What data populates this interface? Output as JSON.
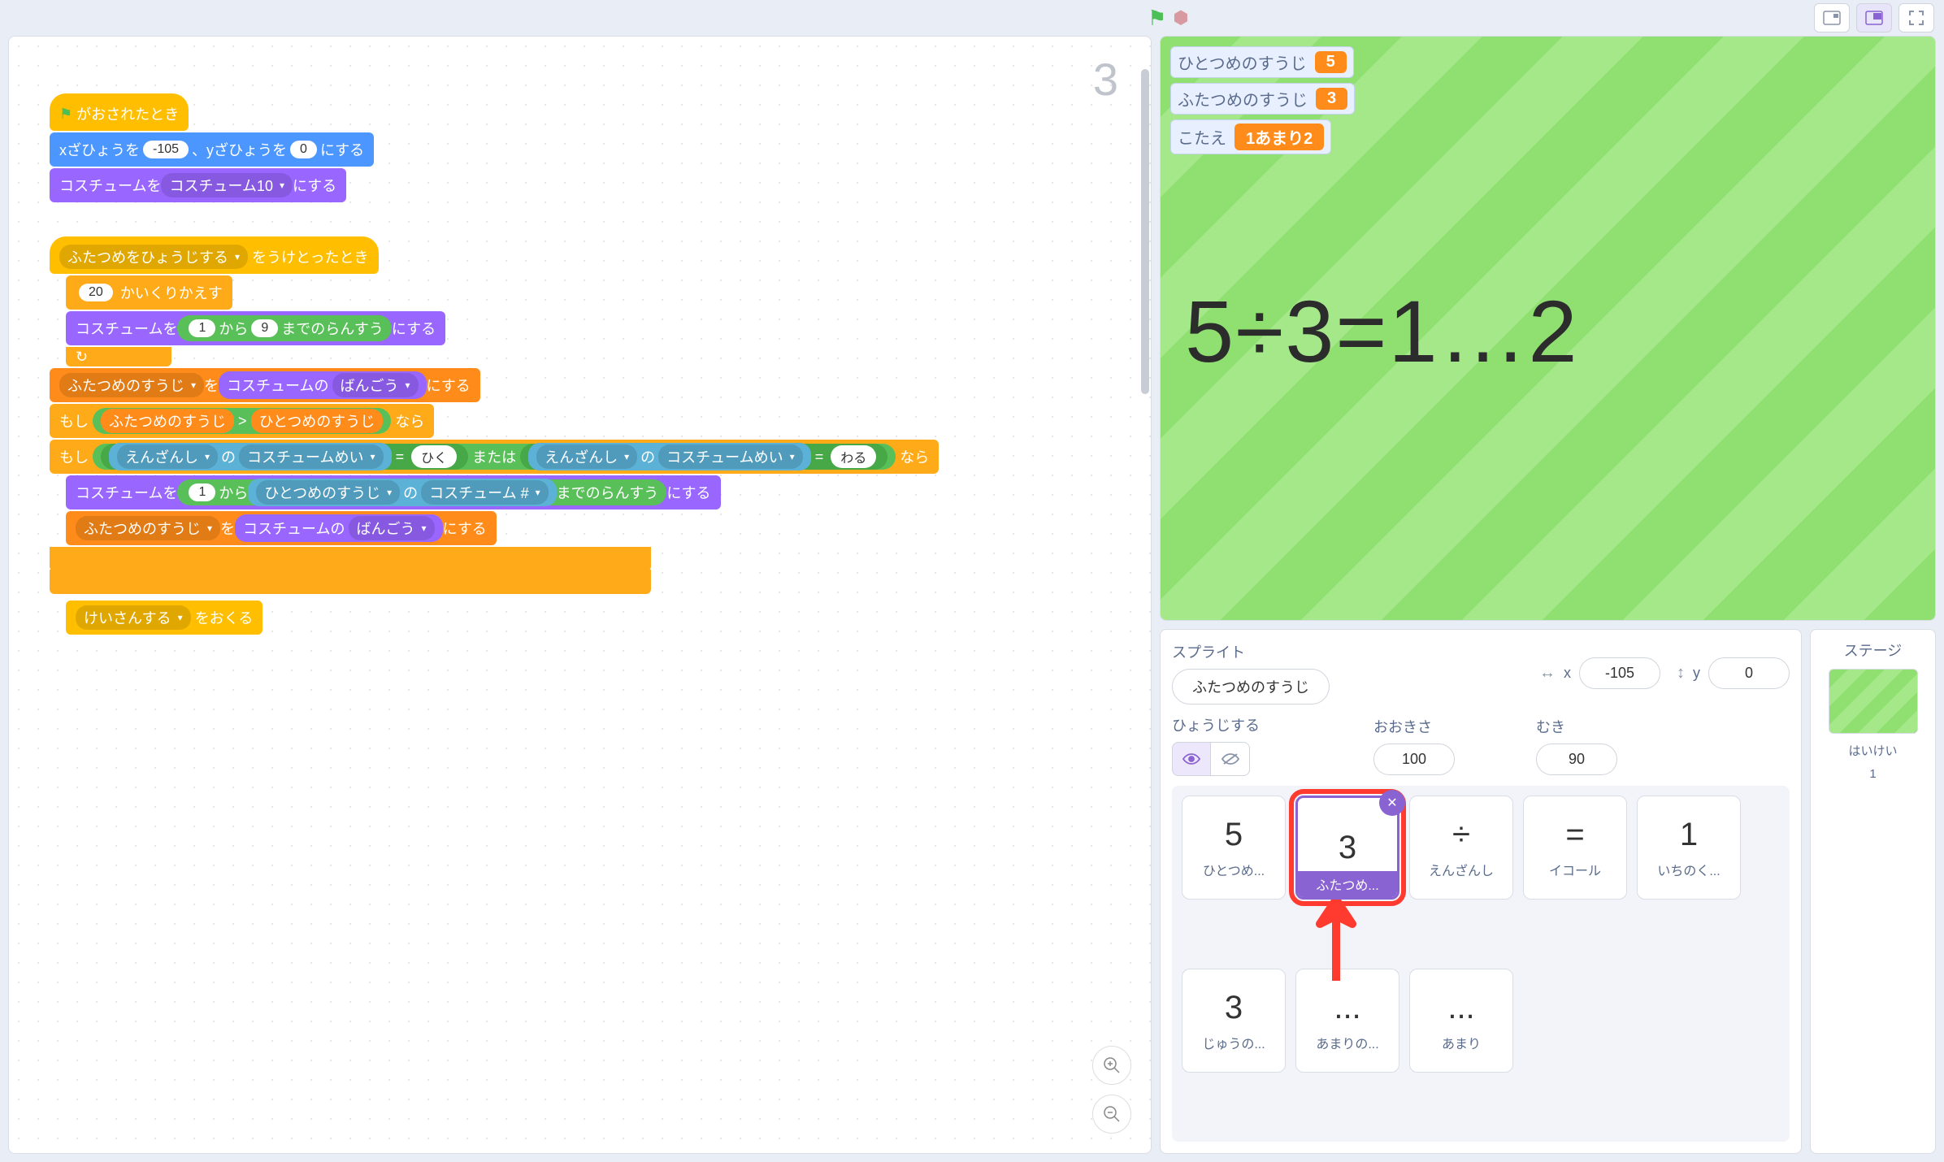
{
  "topbar": {
    "flag_title": "Go",
    "stop_title": "Stop"
  },
  "workspace": {
    "sprite_label": "3",
    "blocks": {
      "hat1": "がおされたとき",
      "goto_pre": "xざひょうを",
      "goto_x": "-105",
      "goto_mid": "、yざひょうを",
      "goto_y": "0",
      "goto_post": "にする",
      "costume_set_pre": "コスチュームを",
      "costume_set_dd": "コスチューム10",
      "costume_set_post": "にする",
      "hat2_pre": "ふたつめをひょうじする",
      "hat2_post": "をうけとったとき",
      "repeat_n": "20",
      "repeat_post": "かいくりかえす",
      "rand_pre": "コスチュームを",
      "rand_from": "1",
      "rand_mid": "から",
      "rand_to": "9",
      "rand_label": "までのらんすう",
      "rand_post": "にする",
      "set_var_name": "ふたつめのすうじ",
      "set_var_mid": "を",
      "costume_num": "コスチュームの",
      "costume_num_dd": "ばんごう",
      "set_var_post": "にする",
      "if_pre": "もし",
      "cmp_left": "ふたつめのすうじ",
      "cmp_op": ">",
      "cmp_right": "ひとつめのすうじ",
      "if_post": "なら",
      "if2_pre": "もし",
      "sense_sprite": "えんざんし",
      "sense_of": "の",
      "sense_prop": "コスチュームめい",
      "eq": "=",
      "hiku": "ひく",
      "or": "または",
      "waru": "わる",
      "if2_post": "なら",
      "rand2_pre": "コスチュームを",
      "rand2_from": "1",
      "rand2_mid": "から",
      "rand2_sprite": "ひとつめのすうじ",
      "rand2_of": "の",
      "rand2_prop": "コスチューム #",
      "rand2_label": "までのらんすう",
      "rand2_post": "にする",
      "set_var2_name": "ふたつめのすうじ",
      "set_var2_mid": "を",
      "set_var2_post": "にする",
      "broadcast_pre": "けいさんする",
      "broadcast_post": "をおくる"
    }
  },
  "stage": {
    "monitors": [
      {
        "label": "ひとつめのすうじ",
        "value": "5"
      },
      {
        "label": "ふたつめのすうじ",
        "value": "3"
      },
      {
        "label": "こたえ",
        "value": "1あまり2"
      }
    ],
    "math_display": "5÷3=1…2"
  },
  "sprite_info": {
    "header": "スプライト",
    "name": "ふたつめのすうじ",
    "x_label": "x",
    "x_value": "-105",
    "y_label": "y",
    "y_value": "0",
    "show_label": "ひょうじする",
    "size_label": "おおきさ",
    "size_value": "100",
    "dir_label": "むき",
    "dir_value": "90"
  },
  "sprite_list": [
    {
      "glyph": "5",
      "name": "ひとつめ..."
    },
    {
      "glyph": "3",
      "name": "ふたつめ...",
      "selected": true,
      "highlighted": true
    },
    {
      "glyph": "÷",
      "name": "えんざんし"
    },
    {
      "glyph": "=",
      "name": "イコール"
    },
    {
      "glyph": "1",
      "name": "いちのく..."
    },
    {
      "glyph": "3",
      "name": "じゅうの..."
    },
    {
      "glyph": "...",
      "name": "あまりの..."
    },
    {
      "glyph": "...",
      "name": "あまり"
    }
  ],
  "stage_panel": {
    "header": "ステージ",
    "backdrop_label": "はいけい",
    "backdrop_count": "1"
  }
}
